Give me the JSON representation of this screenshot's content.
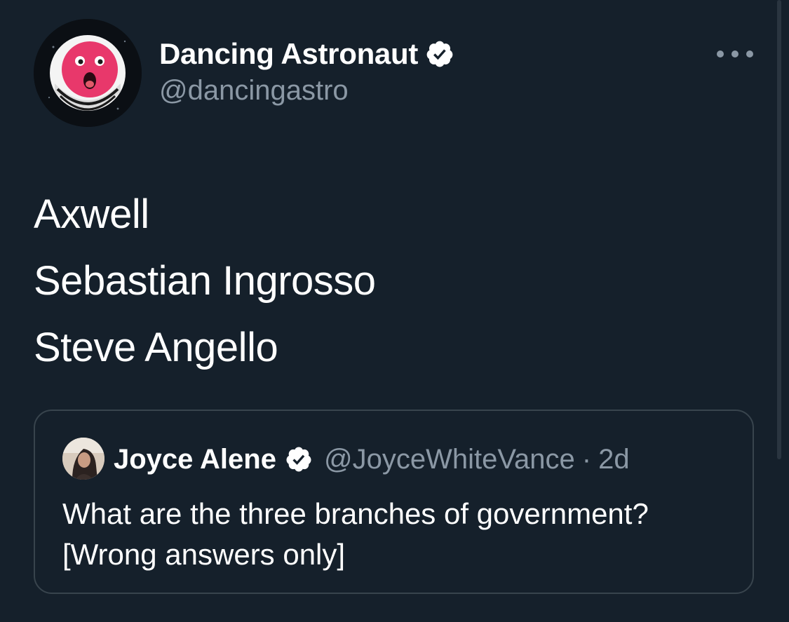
{
  "tweet": {
    "author": {
      "display_name": "Dancing Astronaut",
      "handle": "@dancingastro",
      "verified": true,
      "avatar_icon": "dancing-astronaut-logo"
    },
    "more_icon": "more-options-icon",
    "lines": [
      "Axwell",
      "Sebastian Ingrosso",
      "Steve Angello"
    ]
  },
  "quoted_tweet": {
    "author": {
      "display_name": "Joyce Alene",
      "handle": "@JoyceWhiteVance",
      "verified": true
    },
    "separator": "·",
    "time": "2d",
    "lines": [
      "What are the three branches of government?",
      "[Wrong answers only]"
    ]
  },
  "colors": {
    "background": "#15202b",
    "text_primary": "#ffffff",
    "text_secondary": "#8b98a5",
    "border": "#38444d",
    "logo_pink": "#e8386b"
  }
}
